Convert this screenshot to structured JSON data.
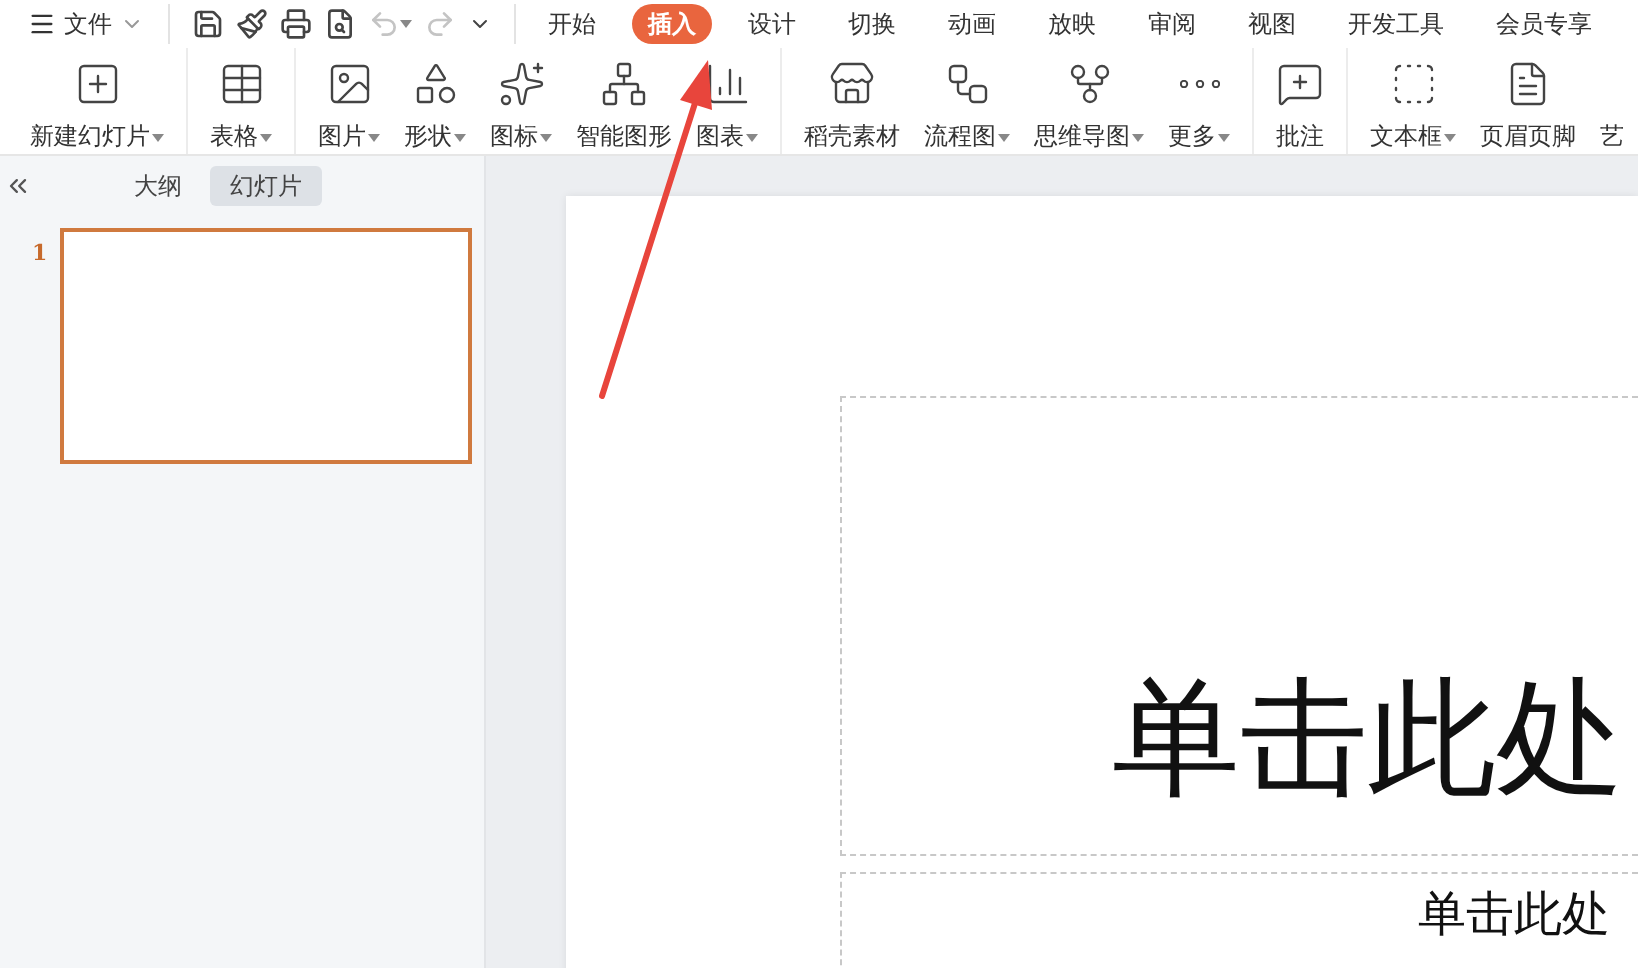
{
  "menu": {
    "label": "文件"
  },
  "quick_access": [
    {
      "kind": "save",
      "disabled": false
    },
    {
      "kind": "painter",
      "disabled": false
    },
    {
      "kind": "print",
      "disabled": false
    },
    {
      "kind": "preview",
      "disabled": false
    },
    {
      "kind": "undo",
      "disabled": true
    },
    {
      "kind": "redo",
      "disabled": true
    },
    {
      "kind": "more",
      "disabled": false
    }
  ],
  "tabs": [
    {
      "label": "开始",
      "selected": false
    },
    {
      "label": "插入",
      "selected": true
    },
    {
      "label": "设计",
      "selected": false
    },
    {
      "label": "切换",
      "selected": false
    },
    {
      "label": "动画",
      "selected": false
    },
    {
      "label": "放映",
      "selected": false
    },
    {
      "label": "审阅",
      "selected": false
    },
    {
      "label": "视图",
      "selected": false
    },
    {
      "label": "开发工具",
      "selected": false
    },
    {
      "label": "会员专享",
      "selected": false
    }
  ],
  "ribbon": {
    "groups": [
      {
        "items": [
          {
            "kind": "new-slide",
            "label": "新建幻灯片",
            "dropdown": true
          }
        ]
      },
      {
        "items": [
          {
            "kind": "table",
            "label": "表格",
            "dropdown": true
          }
        ]
      },
      {
        "items": [
          {
            "kind": "image",
            "label": "图片",
            "dropdown": true
          },
          {
            "kind": "shape",
            "label": "形状",
            "dropdown": true
          },
          {
            "kind": "icons",
            "label": "图标",
            "dropdown": true
          },
          {
            "kind": "smart",
            "label": "智能图形",
            "dropdown": false
          },
          {
            "kind": "chart",
            "label": "图表",
            "dropdown": true
          }
        ]
      },
      {
        "items": [
          {
            "kind": "store",
            "label": "稻壳素材",
            "dropdown": false
          },
          {
            "kind": "flow",
            "label": "流程图",
            "dropdown": true
          },
          {
            "kind": "mind",
            "label": "思维导图",
            "dropdown": true
          },
          {
            "kind": "more",
            "label": "更多",
            "dropdown": true
          }
        ]
      },
      {
        "items": [
          {
            "kind": "comment",
            "label": "批注",
            "dropdown": false
          }
        ]
      },
      {
        "items": [
          {
            "kind": "textbox",
            "label": "文本框",
            "dropdown": true
          },
          {
            "kind": "header",
            "label": "页眉页脚",
            "dropdown": false
          },
          {
            "kind": "none",
            "label": "艺",
            "dropdown": false
          }
        ]
      }
    ]
  },
  "panel": {
    "tabs": [
      {
        "label": "大纲",
        "selected": false
      },
      {
        "label": "幻灯片",
        "selected": true
      }
    ],
    "slides": [
      {
        "number": "1",
        "selected": true
      }
    ]
  },
  "slide": {
    "title": "单击此处",
    "subtitle": "单击此处"
  }
}
